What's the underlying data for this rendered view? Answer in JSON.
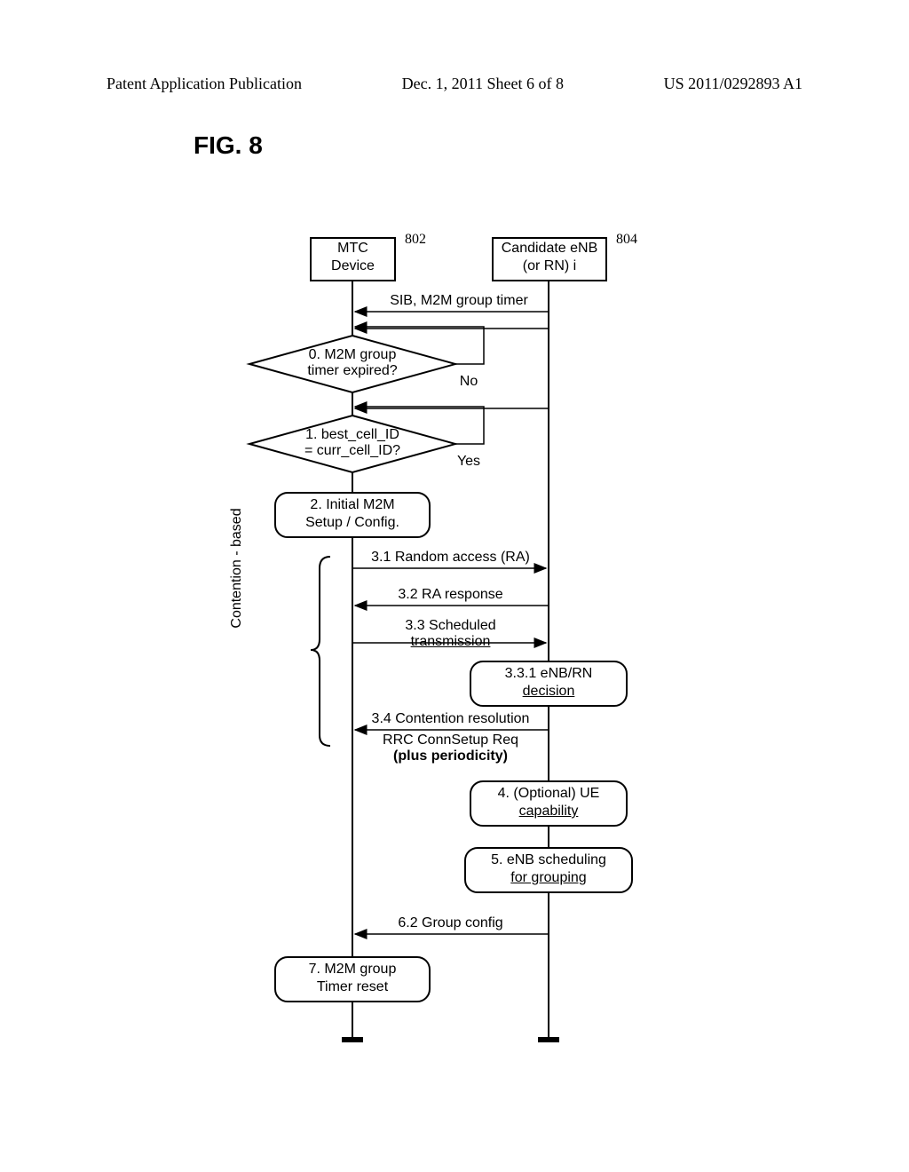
{
  "header": {
    "left": "Patent Application Publication",
    "center": "Dec. 1, 2011  Sheet 6 of 8",
    "right": "US 2011/0292893 A1"
  },
  "figure_title": "FIG. 8",
  "entities": {
    "mtc": {
      "label_l1": "MTC",
      "label_l2": "Device",
      "num": "802"
    },
    "enb": {
      "label_l1": "Candidate eNB",
      "label_l2": "(or RN) i",
      "num": "804"
    }
  },
  "decisions": {
    "d0": {
      "l1": "0. M2M group",
      "l2": "timer expired?",
      "out": "No"
    },
    "d1": {
      "l1": "1. best_cell_ID",
      "l2": "= curr_cell_ID?",
      "out": "Yes"
    }
  },
  "steps": {
    "s2": {
      "l1": "2. Initial M2M",
      "l2": "Setup / Config."
    },
    "s331": {
      "l1": "3.3.1 eNB/RN",
      "l2": "decision"
    },
    "s4": {
      "l1": "4. (Optional) UE",
      "l2": "capability"
    },
    "s5": {
      "l1": "5. eNB scheduling",
      "l2": "for grouping"
    },
    "s7": {
      "l1": "7. M2M group",
      "l2": "Timer reset"
    }
  },
  "messages": {
    "sib": "SIB, M2M group timer",
    "m31": "3.1 Random access (RA)",
    "m32": "3.2 RA response",
    "m33a": "3.3 Scheduled",
    "m33b": "transmission",
    "m34": "3.4 Contention resolution",
    "rrc1": "RRC ConnSetup Req",
    "rrc2": "(plus periodicity)",
    "m62": "6.2 Group config"
  },
  "brace_label": "Contention - based"
}
